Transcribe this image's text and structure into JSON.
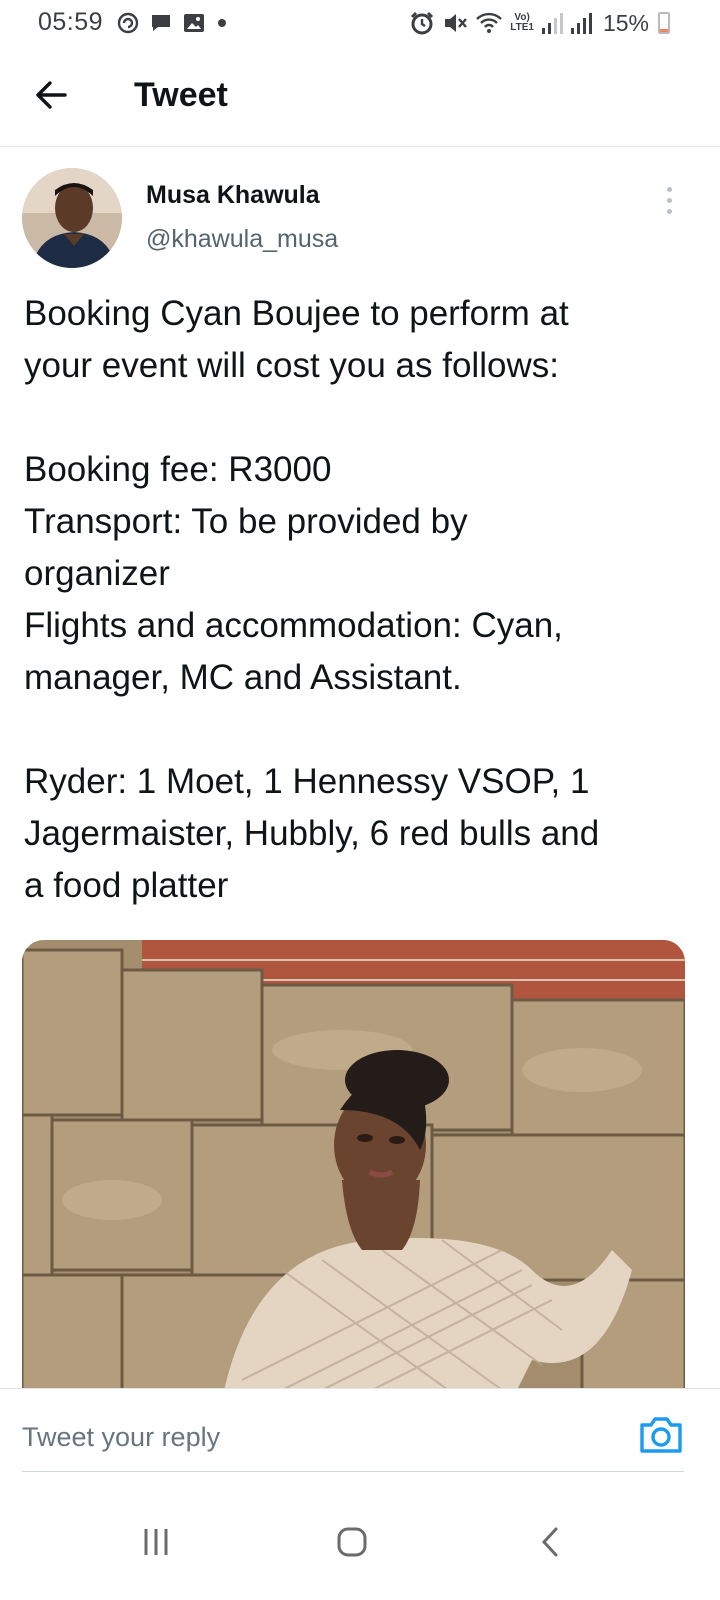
{
  "status_bar": {
    "time": "05:59",
    "lte_label_top": "Vo)",
    "lte_label_bottom": "LTE1",
    "battery_percent": "15%",
    "battery_level": 0.15,
    "icons": [
      "sync-icon",
      "chat-icon",
      "image-icon",
      "dot-icon",
      "alarm-icon",
      "mute-icon",
      "wifi-icon",
      "signal-icon",
      "signal-icon",
      "battery-icon"
    ]
  },
  "header": {
    "back_icon": "arrow-left-icon",
    "title": "Tweet"
  },
  "tweet": {
    "author_name": "Musa Khawula",
    "handle": "@khawula_musa",
    "more_icon": "more-vertical-icon",
    "lines": [
      "Booking Cyan Boujee to perform at",
      "your event will cost you as follows:",
      "",
      "Booking fee: R3000",
      "Transport: To be provided by",
      "organizer",
      "Flights and accommodation: Cyan,",
      "manager, MC and Assistant.",
      "",
      "Ryder: 1 Moet, 1 Hennessy VSOP, 1",
      "Jagermaister, Hubbly, 6 red bulls and",
      "a food platter"
    ]
  },
  "reply": {
    "placeholder": "Tweet your reply",
    "camera_icon": "camera-icon"
  },
  "nav": {
    "icons": [
      "recents-icon",
      "home-icon",
      "back-icon"
    ]
  },
  "colors": {
    "accent": "#1d9bf0",
    "text": "#0f1419",
    "secondary": "#536471"
  }
}
